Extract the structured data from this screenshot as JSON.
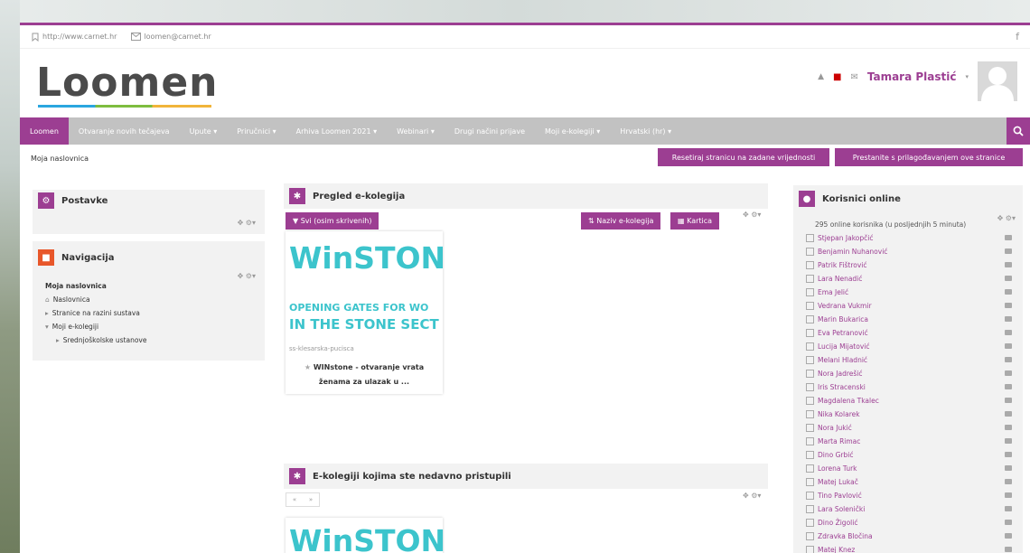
{
  "topbar": {
    "url": "http://www.carnet.hr",
    "email": "loomen@carnet.hr",
    "facebook": "f"
  },
  "logo": "Loomen",
  "user": {
    "name": "Tamara Plastić"
  },
  "nav": {
    "items": [
      "Loomen",
      "Otvaranje novih tečajeva",
      "Upute",
      "Priručnici",
      "Arhiva Loomen 2021",
      "Webinari",
      "Drugi načini prijave",
      "Moji e-kolegiji",
      "Hrvatski (hr)"
    ],
    "dropdowns": [
      false,
      false,
      true,
      true,
      true,
      true,
      false,
      true,
      true
    ]
  },
  "breadcrumb": "Moja naslovnica",
  "buttons": {
    "reset": "Resetiraj stranicu na zadane vrijednosti",
    "stop": "Prestanite s prilagođavanjem ove stranice"
  },
  "postavke": {
    "title": "Postavke"
  },
  "navigacija": {
    "title": "Navigacija",
    "root": "Moja naslovnica",
    "items": [
      "Naslovnica",
      "Stranice na razini sustava",
      "Moji e-kolegiji",
      "Srednjoškolske ustanove"
    ]
  },
  "pregled": {
    "title": "Pregled e-kolegija",
    "filter": "Svi (osim skrivenih)",
    "sort": "Naziv e-kolegija",
    "view": "Kartica",
    "course": {
      "image_title": "WinSTON",
      "image_line1": "OPENING GATES FOR WO",
      "image_line2": "IN THE STONE SECT",
      "category": "ss-klesarska-pucisca",
      "name_line1": "WINstone - otvaranje vrata",
      "name_line2": "ženama za ulazak u ..."
    }
  },
  "recent": {
    "title": "E-kolegiji kojima ste nedavno pristupili",
    "prev": "«",
    "next": "»",
    "image_title": "WinSTON"
  },
  "online": {
    "title": "Korisnici online",
    "summary": "295 online korisnika (u posljednjih 5 minuta)",
    "users": [
      "Stjepan Jakopčić",
      "Benjamin Nuhanović",
      "Patrik Fištrović",
      "Lara Nenadić",
      "Ema Jelić",
      "Vedrana Vukmir",
      "Marin Bukarica",
      "Eva Petranović",
      "Lucija Mijatović",
      "Melani Hladnić",
      "Nora Jadrešić",
      "Iris Stracenski",
      "Magdalena Tkalec",
      "Nika Kolarek",
      "Nora Jukić",
      "Marta Rimac",
      "Dino Grbić",
      "Lorena Turk",
      "Matej Lukač",
      "Tino Pavlović",
      "Lara Solenički",
      "Dino Žigolić",
      "Zdravka Bločina",
      "Matej Knez"
    ]
  },
  "colors": {
    "accent": "#9c3e92",
    "cyan": "#3cc4cc",
    "nav": "#c2c2c2",
    "block": "#f2f2f2"
  }
}
